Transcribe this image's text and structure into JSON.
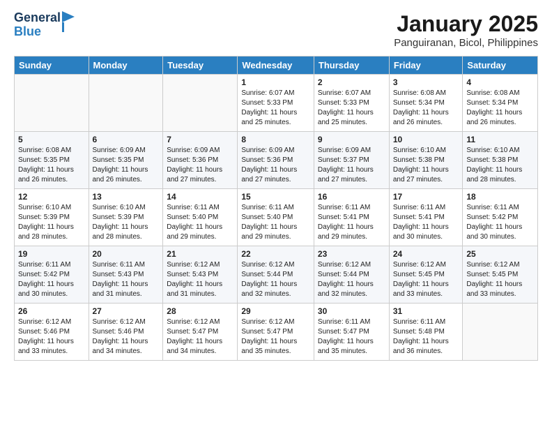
{
  "header": {
    "logo_general": "General",
    "logo_blue": "Blue",
    "month_year": "January 2025",
    "location": "Panguiranan, Bicol, Philippines"
  },
  "days_of_week": [
    "Sunday",
    "Monday",
    "Tuesday",
    "Wednesday",
    "Thursday",
    "Friday",
    "Saturday"
  ],
  "weeks": [
    [
      {
        "day": "",
        "info": ""
      },
      {
        "day": "",
        "info": ""
      },
      {
        "day": "",
        "info": ""
      },
      {
        "day": "1",
        "info": "Sunrise: 6:07 AM\nSunset: 5:33 PM\nDaylight: 11 hours\nand 25 minutes."
      },
      {
        "day": "2",
        "info": "Sunrise: 6:07 AM\nSunset: 5:33 PM\nDaylight: 11 hours\nand 25 minutes."
      },
      {
        "day": "3",
        "info": "Sunrise: 6:08 AM\nSunset: 5:34 PM\nDaylight: 11 hours\nand 26 minutes."
      },
      {
        "day": "4",
        "info": "Sunrise: 6:08 AM\nSunset: 5:34 PM\nDaylight: 11 hours\nand 26 minutes."
      }
    ],
    [
      {
        "day": "5",
        "info": "Sunrise: 6:08 AM\nSunset: 5:35 PM\nDaylight: 11 hours\nand 26 minutes."
      },
      {
        "day": "6",
        "info": "Sunrise: 6:09 AM\nSunset: 5:35 PM\nDaylight: 11 hours\nand 26 minutes."
      },
      {
        "day": "7",
        "info": "Sunrise: 6:09 AM\nSunset: 5:36 PM\nDaylight: 11 hours\nand 27 minutes."
      },
      {
        "day": "8",
        "info": "Sunrise: 6:09 AM\nSunset: 5:36 PM\nDaylight: 11 hours\nand 27 minutes."
      },
      {
        "day": "9",
        "info": "Sunrise: 6:09 AM\nSunset: 5:37 PM\nDaylight: 11 hours\nand 27 minutes."
      },
      {
        "day": "10",
        "info": "Sunrise: 6:10 AM\nSunset: 5:38 PM\nDaylight: 11 hours\nand 27 minutes."
      },
      {
        "day": "11",
        "info": "Sunrise: 6:10 AM\nSunset: 5:38 PM\nDaylight: 11 hours\nand 28 minutes."
      }
    ],
    [
      {
        "day": "12",
        "info": "Sunrise: 6:10 AM\nSunset: 5:39 PM\nDaylight: 11 hours\nand 28 minutes."
      },
      {
        "day": "13",
        "info": "Sunrise: 6:10 AM\nSunset: 5:39 PM\nDaylight: 11 hours\nand 28 minutes."
      },
      {
        "day": "14",
        "info": "Sunrise: 6:11 AM\nSunset: 5:40 PM\nDaylight: 11 hours\nand 29 minutes."
      },
      {
        "day": "15",
        "info": "Sunrise: 6:11 AM\nSunset: 5:40 PM\nDaylight: 11 hours\nand 29 minutes."
      },
      {
        "day": "16",
        "info": "Sunrise: 6:11 AM\nSunset: 5:41 PM\nDaylight: 11 hours\nand 29 minutes."
      },
      {
        "day": "17",
        "info": "Sunrise: 6:11 AM\nSunset: 5:41 PM\nDaylight: 11 hours\nand 30 minutes."
      },
      {
        "day": "18",
        "info": "Sunrise: 6:11 AM\nSunset: 5:42 PM\nDaylight: 11 hours\nand 30 minutes."
      }
    ],
    [
      {
        "day": "19",
        "info": "Sunrise: 6:11 AM\nSunset: 5:42 PM\nDaylight: 11 hours\nand 30 minutes."
      },
      {
        "day": "20",
        "info": "Sunrise: 6:11 AM\nSunset: 5:43 PM\nDaylight: 11 hours\nand 31 minutes."
      },
      {
        "day": "21",
        "info": "Sunrise: 6:12 AM\nSunset: 5:43 PM\nDaylight: 11 hours\nand 31 minutes."
      },
      {
        "day": "22",
        "info": "Sunrise: 6:12 AM\nSunset: 5:44 PM\nDaylight: 11 hours\nand 32 minutes."
      },
      {
        "day": "23",
        "info": "Sunrise: 6:12 AM\nSunset: 5:44 PM\nDaylight: 11 hours\nand 32 minutes."
      },
      {
        "day": "24",
        "info": "Sunrise: 6:12 AM\nSunset: 5:45 PM\nDaylight: 11 hours\nand 33 minutes."
      },
      {
        "day": "25",
        "info": "Sunrise: 6:12 AM\nSunset: 5:45 PM\nDaylight: 11 hours\nand 33 minutes."
      }
    ],
    [
      {
        "day": "26",
        "info": "Sunrise: 6:12 AM\nSunset: 5:46 PM\nDaylight: 11 hours\nand 33 minutes."
      },
      {
        "day": "27",
        "info": "Sunrise: 6:12 AM\nSunset: 5:46 PM\nDaylight: 11 hours\nand 34 minutes."
      },
      {
        "day": "28",
        "info": "Sunrise: 6:12 AM\nSunset: 5:47 PM\nDaylight: 11 hours\nand 34 minutes."
      },
      {
        "day": "29",
        "info": "Sunrise: 6:12 AM\nSunset: 5:47 PM\nDaylight: 11 hours\nand 35 minutes."
      },
      {
        "day": "30",
        "info": "Sunrise: 6:11 AM\nSunset: 5:47 PM\nDaylight: 11 hours\nand 35 minutes."
      },
      {
        "day": "31",
        "info": "Sunrise: 6:11 AM\nSunset: 5:48 PM\nDaylight: 11 hours\nand 36 minutes."
      },
      {
        "day": "",
        "info": ""
      }
    ]
  ]
}
